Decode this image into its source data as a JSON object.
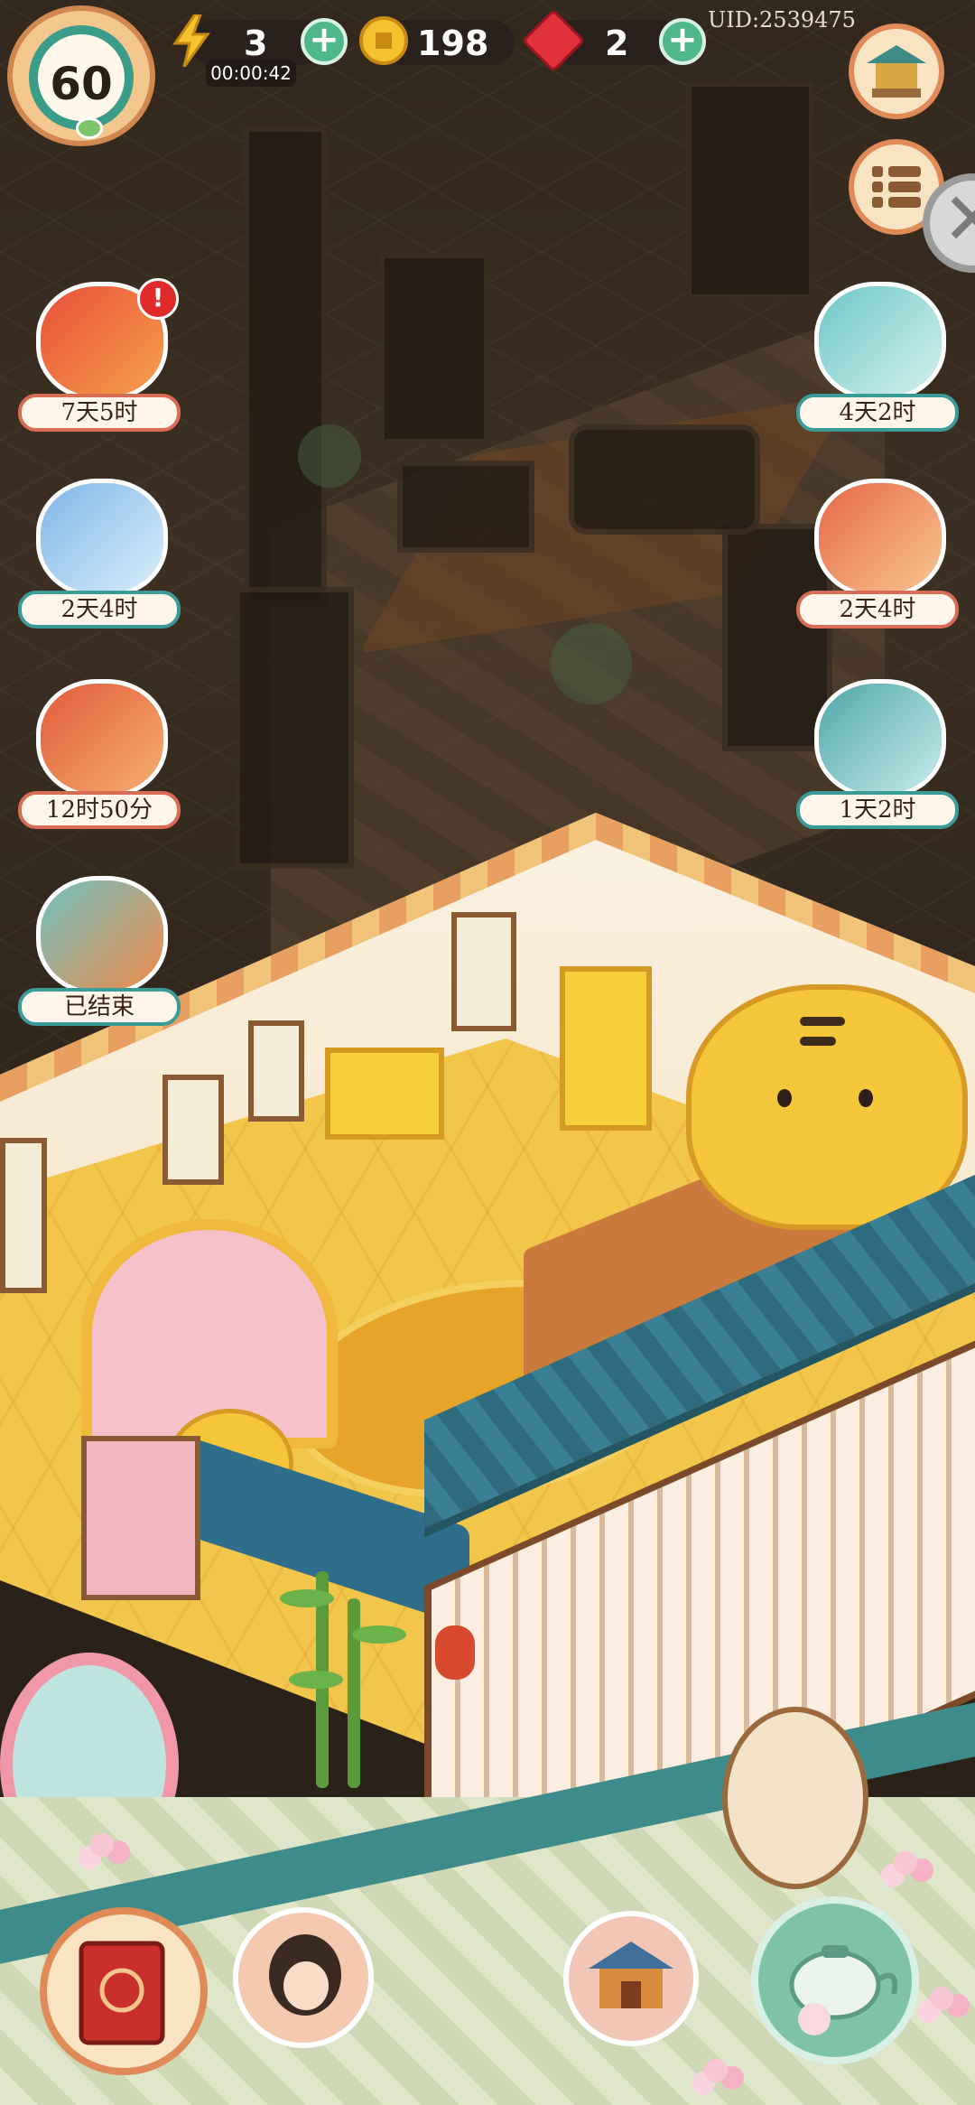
{
  "hud": {
    "level": "60",
    "energy": "3",
    "energy_timer": "00:00:42",
    "coins": "198",
    "rubies": "2",
    "uid": "UID:2539475"
  },
  "events_left": [
    {
      "label": "7天5时",
      "badge": "!"
    },
    {
      "label": "2天4时"
    },
    {
      "label": "12时50分"
    },
    {
      "label": "已结束"
    }
  ],
  "events_right": [
    {
      "label": "4天2时"
    },
    {
      "label": "2天4时"
    },
    {
      "label": "1天2时"
    }
  ],
  "icons": {
    "energy": "lightning-icon",
    "coin": "coin-icon",
    "ruby": "ruby-icon",
    "shop": "pavilion-icon",
    "menu": "list-menu-icon",
    "close": "close-icon",
    "plus": "plus-icon"
  },
  "colors": {
    "plus_green": "#4fb78a",
    "label_border_red": "#d86d56",
    "label_border_teal": "#3a9b98",
    "level_ring": "#3b9c8a"
  }
}
